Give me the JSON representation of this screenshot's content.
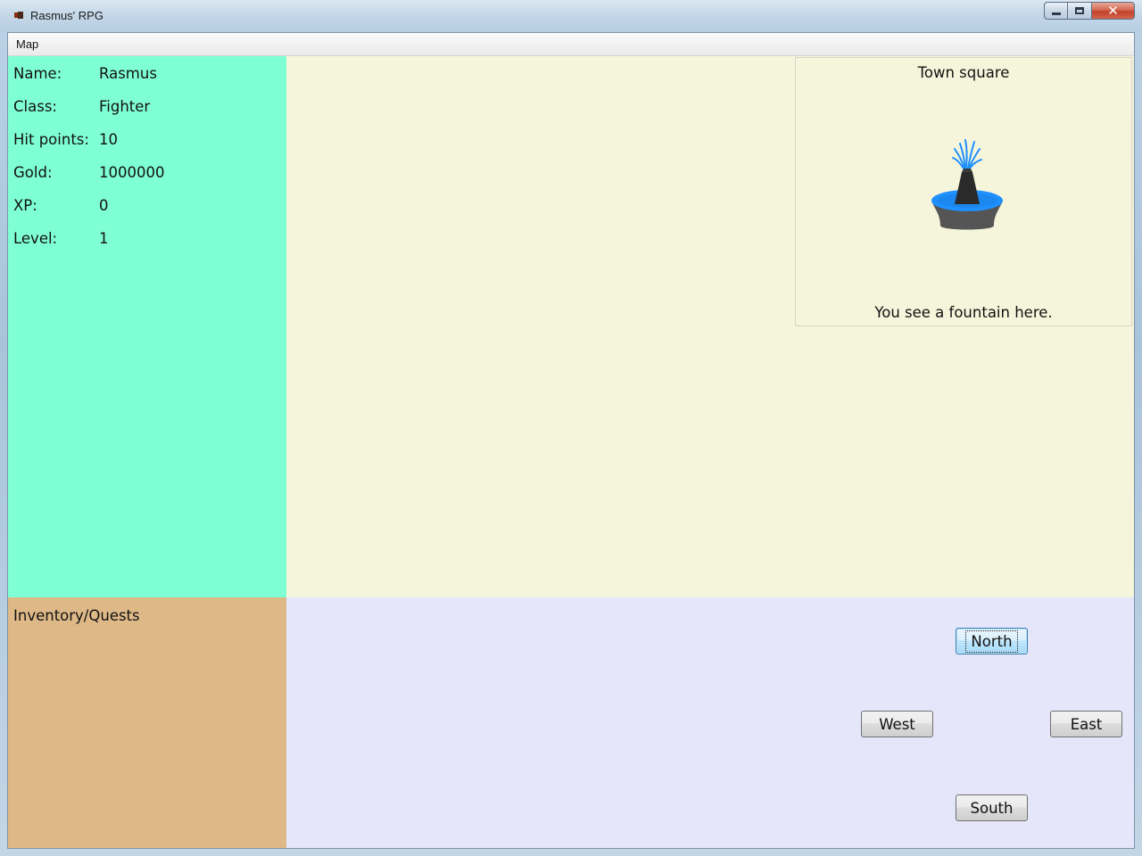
{
  "window": {
    "title": "Rasmus' RPG",
    "controls": {
      "close_glyph": "✕"
    }
  },
  "menu": {
    "items": [
      {
        "label": "Map"
      }
    ]
  },
  "stats": {
    "name_label": "Name:",
    "name_value": "Rasmus",
    "class_label": "Class:",
    "class_value": "Fighter",
    "hp_label": "Hit points:",
    "hp_value": "10",
    "gold_label": "Gold:",
    "gold_value": "1000000",
    "xp_label": "XP:",
    "xp_value": "0",
    "level_label": "Level:",
    "level_value": "1"
  },
  "location": {
    "name": "Town square",
    "description": "You see a fountain here.",
    "image_icon": "fountain-icon"
  },
  "inventory": {
    "title": "Inventory/Quests"
  },
  "controls": {
    "north": "North",
    "west": "West",
    "east": "East",
    "south": "South",
    "focused": "north"
  },
  "colors": {
    "stats_bg": "#7fffd4",
    "world_bg": "#f5f5dc",
    "inventory_bg": "#deb887",
    "controls_bg": "#e6e6fa",
    "fountain_water": "#1e90ff",
    "fountain_stone": "#555555"
  }
}
